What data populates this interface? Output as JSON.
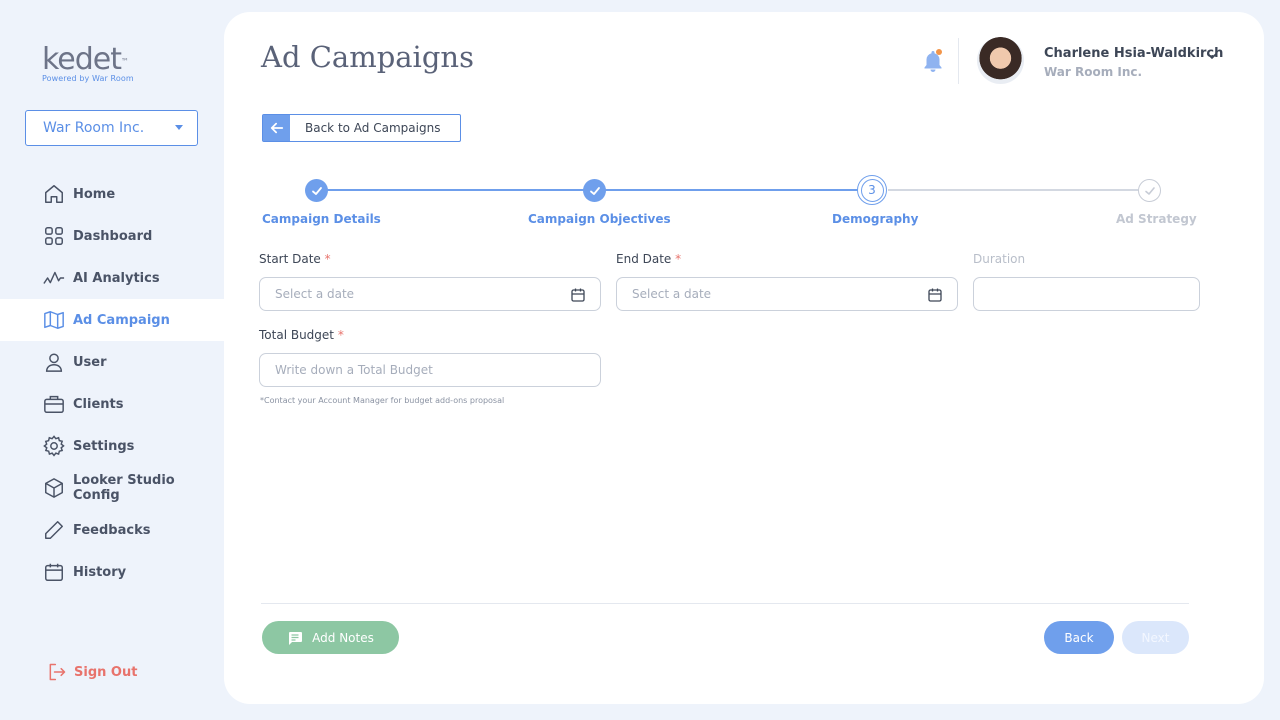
{
  "brand": {
    "logo_text": "kedet",
    "logo_tm": "™",
    "logo_subtitle": "Powered by War Room",
    "accent_color": "#5b8fe6"
  },
  "sidebar": {
    "org_selector": {
      "value": "War Room Inc."
    },
    "items": [
      {
        "label": "Home",
        "icon": "home-icon"
      },
      {
        "label": "Dashboard",
        "icon": "dashboard-grid-icon"
      },
      {
        "label": "AI Analytics",
        "icon": "pulse-chart-icon"
      },
      {
        "label": "Ad Campaign",
        "icon": "map-icon",
        "active": true
      },
      {
        "label": "User",
        "icon": "user-icon"
      },
      {
        "label": "Clients",
        "icon": "briefcase-icon"
      },
      {
        "label": "Settings",
        "icon": "gear-icon"
      },
      {
        "label": "Looker Studio Config",
        "icon": "cube-icon"
      },
      {
        "label": "Feedbacks",
        "icon": "pencil-icon"
      },
      {
        "label": "History",
        "icon": "calendar-icon"
      }
    ],
    "sign_out": "Sign Out"
  },
  "header": {
    "title": "Ad Campaigns",
    "user": {
      "name": "Charlene Hsia-Waldkirch",
      "org": "War Room Inc."
    }
  },
  "back_link": "Back to Ad Campaigns",
  "stepper": {
    "steps": [
      {
        "label": "Campaign Details",
        "state": "done"
      },
      {
        "label": "Campaign Objectives",
        "state": "done"
      },
      {
        "label": "Demography",
        "state": "current",
        "number": "3"
      },
      {
        "label": "Ad Strategy",
        "state": "todo"
      }
    ]
  },
  "form": {
    "start_date": {
      "label": "Start Date",
      "required": "*",
      "placeholder": "Select a date"
    },
    "end_date": {
      "label": "End Date",
      "required": "*",
      "placeholder": "Select a date"
    },
    "duration": {
      "label": "Duration",
      "value": ""
    },
    "total_budget": {
      "label": "Total Budget",
      "required": "*",
      "placeholder": "Write down a Total Budget"
    },
    "hint": "*Contact your Account Manager for budget add-ons proposal"
  },
  "footer": {
    "add_notes": "Add Notes",
    "back": "Back",
    "next": "Next"
  }
}
